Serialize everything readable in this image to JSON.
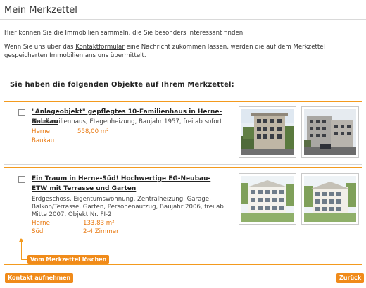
{
  "header": {
    "title": "Mein Merkzettel"
  },
  "intro": {
    "text1": "Hier können Sie die Immobilien sammeln, die Sie besonders interessant finden.",
    "text2_before": "Wenn Sie uns über das ",
    "text2_link": "Kontaktformular",
    "text2_after": " eine Nachricht zukommen lassen, werden die auf dem Merkzettel gespeicherten Immobilien ans uns übermittelt."
  },
  "section": {
    "heading": "Sie haben die folgenden Objekte auf Ihrem Merkzettel:"
  },
  "items": [
    {
      "title": "\"Anlageobjekt\" gepflegtes 10-Familienhaus in Herne-Baukau",
      "description": "Mehrfamilienhaus, Etagenheizung, Baujahr 1957, frei ab sofort",
      "location_city": "Herne",
      "location_district": "Baukau",
      "area": "558,00 m²",
      "thumbs": [
        "building-photo-icon",
        "street-photo-icon"
      ]
    },
    {
      "title": "Ein Traum in Herne-Süd! Hochwertige EG-Neubau-ETW mit Terrasse und Garten",
      "description": "Erdgeschoss, Eigentumswohnung, Zentralheizung, Garage, Balkon/Terrasse, Garten, Personenaufzug, Baujahr 2006, frei ab Mitte 2007, Objekt Nr. FI-2",
      "location_city": "Herne",
      "location_district": "Süd",
      "area": "133,83 m²",
      "rooms": "2-4 Zimmer",
      "thumbs": [
        "rendering-photo-icon",
        "rendering-photo-icon"
      ]
    }
  ],
  "buttons": {
    "remove": "Vom Merkzettel löschen",
    "contact": "Kontakt aufnehmen",
    "back": "Zurück"
  },
  "colors": {
    "accent": "#f39a1e",
    "button": "#f08b1a",
    "highlight_text": "#e8780f"
  }
}
